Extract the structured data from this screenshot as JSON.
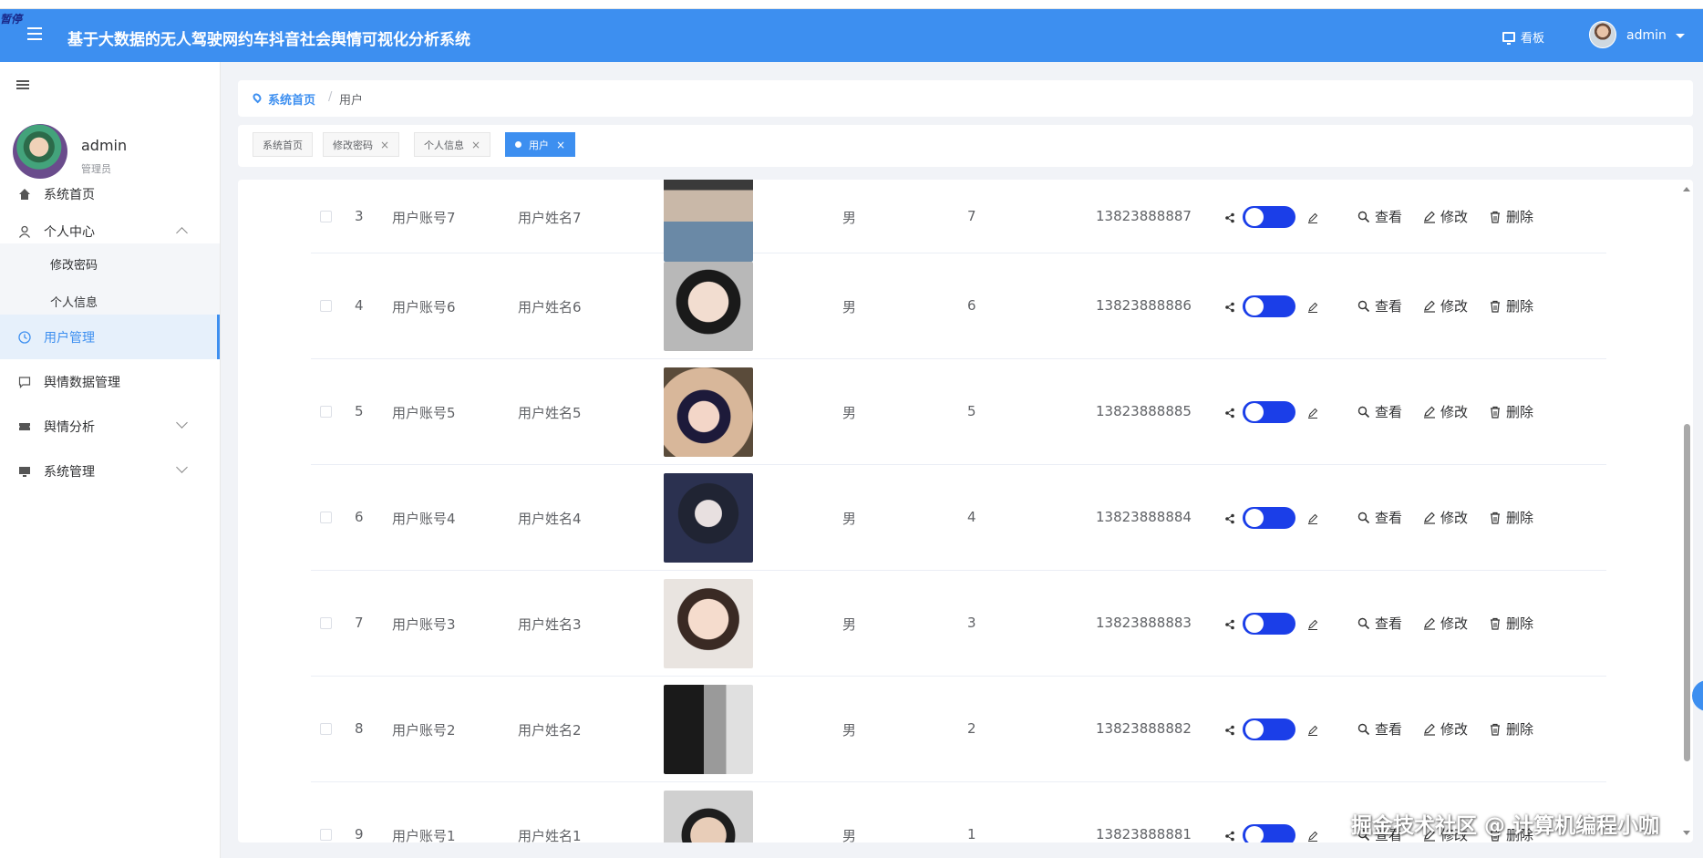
{
  "corner_mark": "暂停",
  "header": {
    "title": "基于大数据的无人驾驶网约车抖音社会舆情可视化分析系统",
    "board_label": "看板",
    "user": "admin"
  },
  "sidebar": {
    "name": "admin",
    "role": "管理员",
    "items": [
      {
        "label": "系统首页",
        "icon": "home-icon"
      },
      {
        "label": "个人中心",
        "icon": "user-icon"
      },
      {
        "label": "修改密码"
      },
      {
        "label": "个人信息"
      },
      {
        "label": "用户管理",
        "icon": "clock-icon"
      },
      {
        "label": "舆情数据管理",
        "icon": "chat-icon"
      },
      {
        "label": "舆情分析",
        "icon": "ticket-icon"
      },
      {
        "label": "系统管理",
        "icon": "monitor-icon"
      }
    ]
  },
  "breadcrumb": {
    "home": "系统首页",
    "separator": "/",
    "current": "用户"
  },
  "tabs": [
    {
      "label": "系统首页"
    },
    {
      "label": "修改密码",
      "close": "×"
    },
    {
      "label": "个人信息",
      "close": "×"
    },
    {
      "label": "用户",
      "close": "×"
    }
  ],
  "actions": {
    "view": "查看",
    "edit": "修改",
    "delete": "删除"
  },
  "rows": [
    {
      "index": "3",
      "account": "用户账号7",
      "name": "用户姓名7",
      "gender": "男",
      "age": "7",
      "phone": "13823888887",
      "switch_on": true
    },
    {
      "index": "4",
      "account": "用户账号6",
      "name": "用户姓名6",
      "gender": "男",
      "age": "6",
      "phone": "13823888886",
      "switch_on": true
    },
    {
      "index": "5",
      "account": "用户账号5",
      "name": "用户姓名5",
      "gender": "男",
      "age": "5",
      "phone": "13823888885",
      "switch_on": true
    },
    {
      "index": "6",
      "account": "用户账号4",
      "name": "用户姓名4",
      "gender": "男",
      "age": "4",
      "phone": "13823888884",
      "switch_on": true
    },
    {
      "index": "7",
      "account": "用户账号3",
      "name": "用户姓名3",
      "gender": "男",
      "age": "3",
      "phone": "13823888883",
      "switch_on": true
    },
    {
      "index": "8",
      "account": "用户账号2",
      "name": "用户姓名2",
      "gender": "男",
      "age": "2",
      "phone": "13823888882",
      "switch_on": true
    },
    {
      "index": "9",
      "account": "用户账号1",
      "name": "用户姓名1",
      "gender": "男",
      "age": "1",
      "phone": "13823888881",
      "switch_on": true
    }
  ],
  "watermark": "掘金技术社区 @ 计算机编程小咖",
  "colors": {
    "header": "#3d8ff0",
    "switch": "#1b3ee8",
    "active_nav": "#3d8ff0"
  }
}
